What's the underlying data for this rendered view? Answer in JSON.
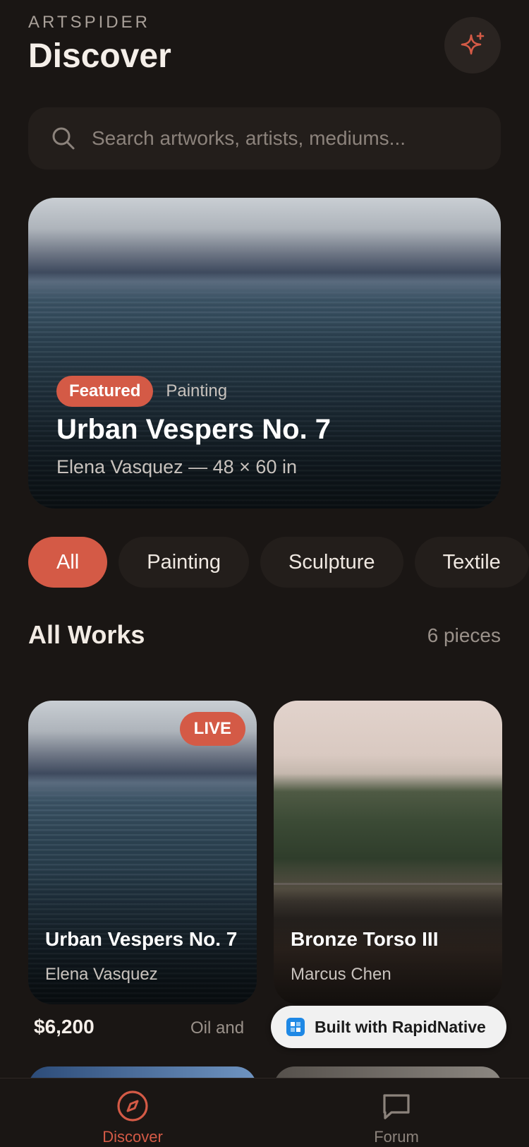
{
  "header": {
    "brand": "ARTSPIDER",
    "title": "Discover",
    "action_icon": "sparkle-icon"
  },
  "search": {
    "placeholder": "Search artworks, artists, mediums..."
  },
  "featured": {
    "badge": "Featured",
    "category": "Painting",
    "title": "Urban Vespers No. 7",
    "meta": "Elena Vasquez — 48 × 60 in"
  },
  "filters": [
    "All",
    "Painting",
    "Sculpture",
    "Textile"
  ],
  "section": {
    "title": "All Works",
    "count": "6 pieces"
  },
  "cards": [
    {
      "badge": "LIVE",
      "title": "Urban Vespers No. 7",
      "artist": "Elena Vasquez",
      "price": "$6,200",
      "medium": "Oil and"
    },
    {
      "title": "Bronze Torso III",
      "artist": "Marcus Chen"
    }
  ],
  "built_with": "Built with RapidNative",
  "tabs": [
    {
      "label": "Discover",
      "icon": "compass-icon"
    },
    {
      "label": "Forum",
      "icon": "chat-bubble-icon"
    }
  ],
  "colors": {
    "background": "#1a1614",
    "accent": "#d45a46",
    "surface": "#231e1b"
  }
}
